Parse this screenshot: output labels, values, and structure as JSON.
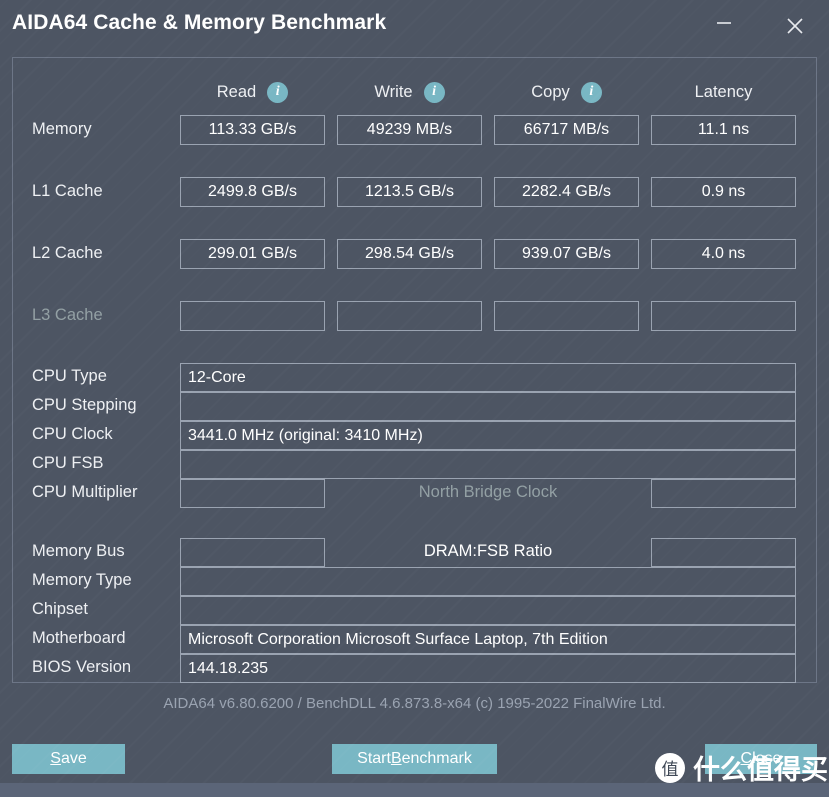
{
  "window": {
    "title": "AIDA64 Cache & Memory Benchmark",
    "minimize_icon": "minimize-icon",
    "close_icon": "close-icon"
  },
  "columns": [
    {
      "label": "Read",
      "has_info": true,
      "info_icon": "info-icon"
    },
    {
      "label": "Write",
      "has_info": true,
      "info_icon": "info-icon"
    },
    {
      "label": "Copy",
      "has_info": true,
      "info_icon": "info-icon"
    },
    {
      "label": "Latency",
      "has_info": false,
      "info_icon": ""
    }
  ],
  "benchmarks": [
    {
      "label": "Memory",
      "dim": false,
      "read": "113.33 GB/s",
      "write": "49239 MB/s",
      "copy": "66717 MB/s",
      "latency": "11.1 ns"
    },
    {
      "label": "L1 Cache",
      "dim": false,
      "read": "2499.8 GB/s",
      "write": "1213.5 GB/s",
      "copy": "2282.4 GB/s",
      "latency": "0.9 ns"
    },
    {
      "label": "L2 Cache",
      "dim": false,
      "read": "299.01 GB/s",
      "write": "298.54 GB/s",
      "copy": "939.07 GB/s",
      "latency": "4.0 ns"
    },
    {
      "label": "L3 Cache",
      "dim": true,
      "read": "",
      "write": "",
      "copy": "",
      "latency": ""
    }
  ],
  "cpu_info": {
    "type_label": "CPU Type",
    "type_value": "12-Core",
    "stepping_label": "CPU Stepping",
    "stepping_value": "",
    "clock_label": "CPU Clock",
    "clock_value": "3441.0 MHz  (original: 3410 MHz)",
    "fsb_label": "CPU FSB",
    "fsb_value": "",
    "multiplier_label": "CPU Multiplier",
    "multiplier_value": "",
    "north_bridge_label": "North Bridge Clock",
    "north_bridge_value": ""
  },
  "memory_info": {
    "bus_label": "Memory Bus",
    "bus_value": "",
    "dram_ratio_label": "DRAM:FSB Ratio",
    "dram_ratio_value": "",
    "type_label": "Memory Type",
    "type_value": "",
    "chipset_label": "Chipset",
    "chipset_value": "",
    "motherboard_label": "Motherboard",
    "motherboard_value": "Microsoft Corporation Microsoft Surface Laptop, 7th Edition",
    "bios_label": "BIOS Version",
    "bios_value": "144.18.235"
  },
  "footer": {
    "version_text": "AIDA64 v6.80.6200 / BenchDLL 4.6.873.8-x64  (c) 1995-2022 FinalWire Ltd."
  },
  "buttons": {
    "save": {
      "prefix": "",
      "accel": "S",
      "suffix": "ave"
    },
    "benchmark": {
      "prefix": "Start ",
      "accel": "B",
      "suffix": "enchmark"
    },
    "close": {
      "prefix": "",
      "accel": "C",
      "suffix": "lose"
    }
  },
  "watermark": {
    "badge": "值",
    "text": "什么值得买"
  },
  "colors": {
    "background": "#4d5563",
    "accent": "#79b7c4",
    "field_border": "#9aa3b1",
    "panel_border": "#6d7687",
    "dim_text": "#93a0a4",
    "statusbar": "#5b6578"
  }
}
